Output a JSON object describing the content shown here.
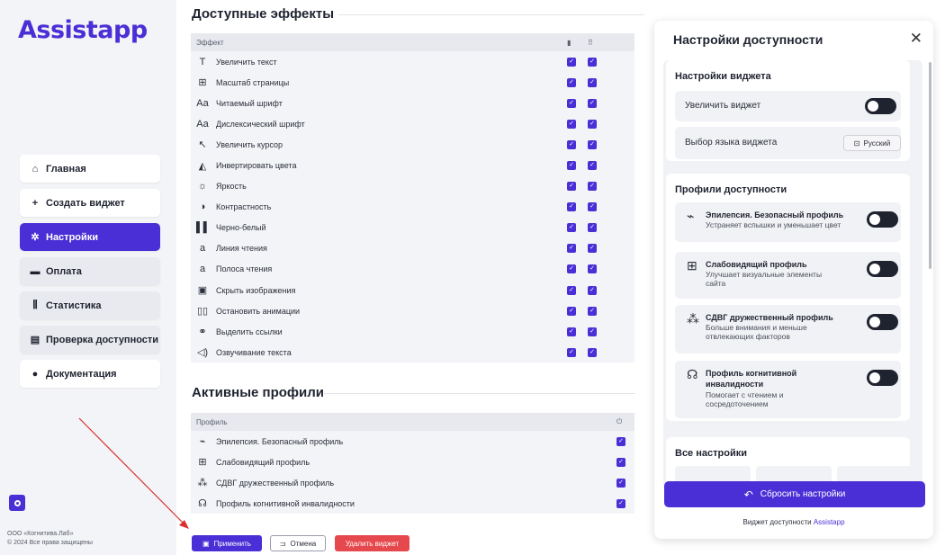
{
  "app": {
    "logo": "Assistapp"
  },
  "sidebar": {
    "items": [
      {
        "label": "Главная",
        "icon": "home-icon",
        "glyph": "⌂"
      },
      {
        "label": "Создать виджет",
        "icon": "plus-icon",
        "glyph": "+"
      },
      {
        "label": "Настройки",
        "icon": "gear-icon",
        "glyph": "✲"
      },
      {
        "label": "Оплата",
        "icon": "card-icon",
        "glyph": "▬"
      },
      {
        "label": "Статистика",
        "icon": "chart-icon",
        "glyph": "⫼"
      },
      {
        "label": "Проверка доступности",
        "icon": "document-icon",
        "glyph": "▤"
      },
      {
        "label": "Документация",
        "icon": "info-icon",
        "glyph": "●"
      }
    ],
    "footer_line1": "ООО «Когнитива.Лаб»",
    "footer_line2": "© 2024 Все права защищены"
  },
  "effects": {
    "title": "Доступные эффекты",
    "header": "Эффект",
    "rows": [
      {
        "label": "Увеличить текст",
        "glyph": "T"
      },
      {
        "label": "Масштаб страницы",
        "glyph": "⊞"
      },
      {
        "label": "Читаемый шрифт",
        "glyph": "Aa"
      },
      {
        "label": "Дислексический шрифт",
        "glyph": "Aa"
      },
      {
        "label": "Увеличить курсор",
        "glyph": "↖"
      },
      {
        "label": "Инвертировать цвета",
        "glyph": "◭"
      },
      {
        "label": "Яркость",
        "glyph": "☼"
      },
      {
        "label": "Контрастность",
        "glyph": "◑"
      },
      {
        "label": "Черно-белый",
        "glyph": "▌▌"
      },
      {
        "label": "Линия чтения",
        "glyph": "a"
      },
      {
        "label": "Полоса чтения",
        "glyph": "a"
      },
      {
        "label": "Скрыть изображения",
        "glyph": "▣"
      },
      {
        "label": "Остановить анимации",
        "glyph": "▯▯"
      },
      {
        "label": "Выделить ссылки",
        "glyph": "⚭"
      },
      {
        "label": "Озвучивание текста",
        "glyph": "◁)"
      }
    ]
  },
  "profiles": {
    "title": "Активные профили",
    "header": "Профиль",
    "rows": [
      {
        "label": "Эпилепсия. Безопасный профиль",
        "glyph": "⌁"
      },
      {
        "label": "Слабовидящий профиль",
        "glyph": "⊞"
      },
      {
        "label": "СДВГ дружественный профиль",
        "glyph": "⁂"
      },
      {
        "label": "Профиль когнитивной инвалидности",
        "glyph": "☊"
      }
    ]
  },
  "actions": {
    "apply": "Применить",
    "cancel": "Отмена",
    "delete": "Удалить виджет"
  },
  "panel": {
    "title": "Настройки доступности",
    "widget_settings_title": "Настройки виджета",
    "enlarge_widget": "Увеличить виджет",
    "language_label": "Выбор языка виджета",
    "language_value": "Русский",
    "profiles_title": "Профили доступности",
    "profiles": [
      {
        "name": "Эпилепсия. Безопасный профиль",
        "desc": "Устраняет вспышки и уменьшает цвет",
        "glyph": "⌁"
      },
      {
        "name": "Слабовидящий профиль",
        "desc": "Улучшает визуальные элементы сайта",
        "glyph": "⊞"
      },
      {
        "name": "СДВГ дружественный профиль",
        "desc": "Больше внимания и меньше отвлекающих факторов",
        "glyph": "⁂"
      },
      {
        "name": "Профиль когнитивной инвалидности",
        "desc": "Помогает с чтением и сосредоточением",
        "glyph": "☊"
      }
    ],
    "all_settings_title": "Все настройки",
    "reset_label": "Сбросить настройки",
    "footer_text": "Виджет доступности",
    "footer_link": "Assistapp"
  },
  "colors": {
    "accent": "#4b2fd6",
    "danger": "#e5484d",
    "toggle_off": "#1f2330"
  }
}
